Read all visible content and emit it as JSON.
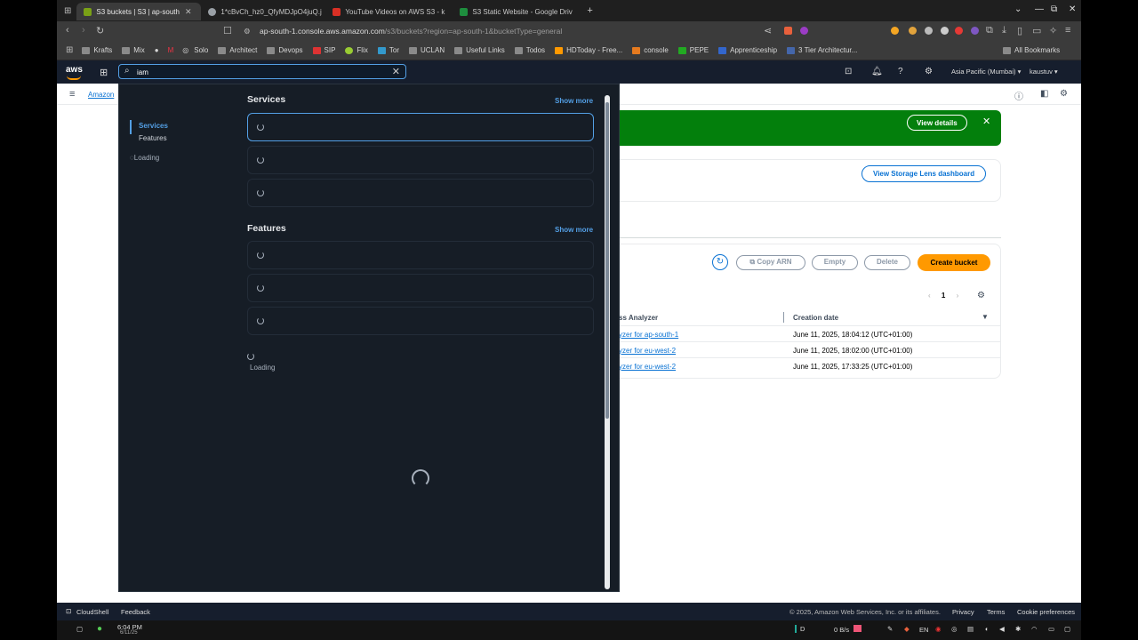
{
  "tabs": [
    {
      "title": "S3 buckets | S3 | ap-south",
      "active": true,
      "color": "#7aa116"
    },
    {
      "title": "1*cBvCh_hz0_QfyMDJpO4juQ.j",
      "active": false,
      "color": "#9aa0a6"
    },
    {
      "title": "YouTube Videos on AWS S3 - k",
      "active": false,
      "color": "#d93025"
    },
    {
      "title": "S3 Static Website - Google Driv",
      "active": false,
      "color": "#1e8e3e"
    }
  ],
  "address": {
    "host": "ap-south-1.console.aws.amazon.com",
    "path": "/s3/buckets?region=ap-south-1&bucketType=general"
  },
  "bookmarks": [
    "Krafts",
    "Mix",
    "Solo",
    "Architect",
    "Devops",
    "SIP",
    "Flix",
    "Tor",
    "UCLAN",
    "Useful Links",
    "Todos",
    "HDToday - Free...",
    "console",
    "PEPE",
    "Apprenticeship",
    "3 Tier Architectur..."
  ],
  "all_bookmarks": "All Bookmarks",
  "aws": {
    "logo": "aws",
    "search_value": "iam",
    "region": "Asia Pacific (Mumbai) ▾",
    "user": "kaustuv ▾"
  },
  "search_panel": {
    "nav_services": "Services",
    "nav_features": "Features",
    "nav_loading": "Loading",
    "services_heading": "Services",
    "features_heading": "Features",
    "show_more": "Show more",
    "loading": "Loading"
  },
  "page": {
    "breadcrumb": "Amazon",
    "view_details": "View details",
    "lens_button": "View Storage Lens dashboard",
    "copy_arn": "Copy ARN",
    "empty": "Empty",
    "delete": "Delete",
    "create_bucket": "Create bucket",
    "page_number": "1",
    "col_analyzer": "ss Analyzer",
    "col_created": "Creation date",
    "rows": [
      {
        "name": "yzer for ap-south-1",
        "date": "June 11, 2025, 18:04:12 (UTC+01:00)"
      },
      {
        "name": "yzer for eu-west-2",
        "date": "June 11, 2025, 18:02:00 (UTC+01:00)"
      },
      {
        "name": "yzer for eu-west-2",
        "date": "June 11, 2025, 17:33:25 (UTC+01:00)"
      }
    ]
  },
  "footer": {
    "cloudshell": "CloudShell",
    "feedback": "Feedback",
    "copyright": "© 2025, Amazon Web Services, Inc. or its affiliates.",
    "privacy": "Privacy",
    "terms": "Terms",
    "cookies": "Cookie preferences"
  },
  "taskbar": {
    "time": "6:04 PM",
    "date": "6/11/25",
    "net": "0 B/s",
    "lang": "EN",
    "desk": "D"
  }
}
